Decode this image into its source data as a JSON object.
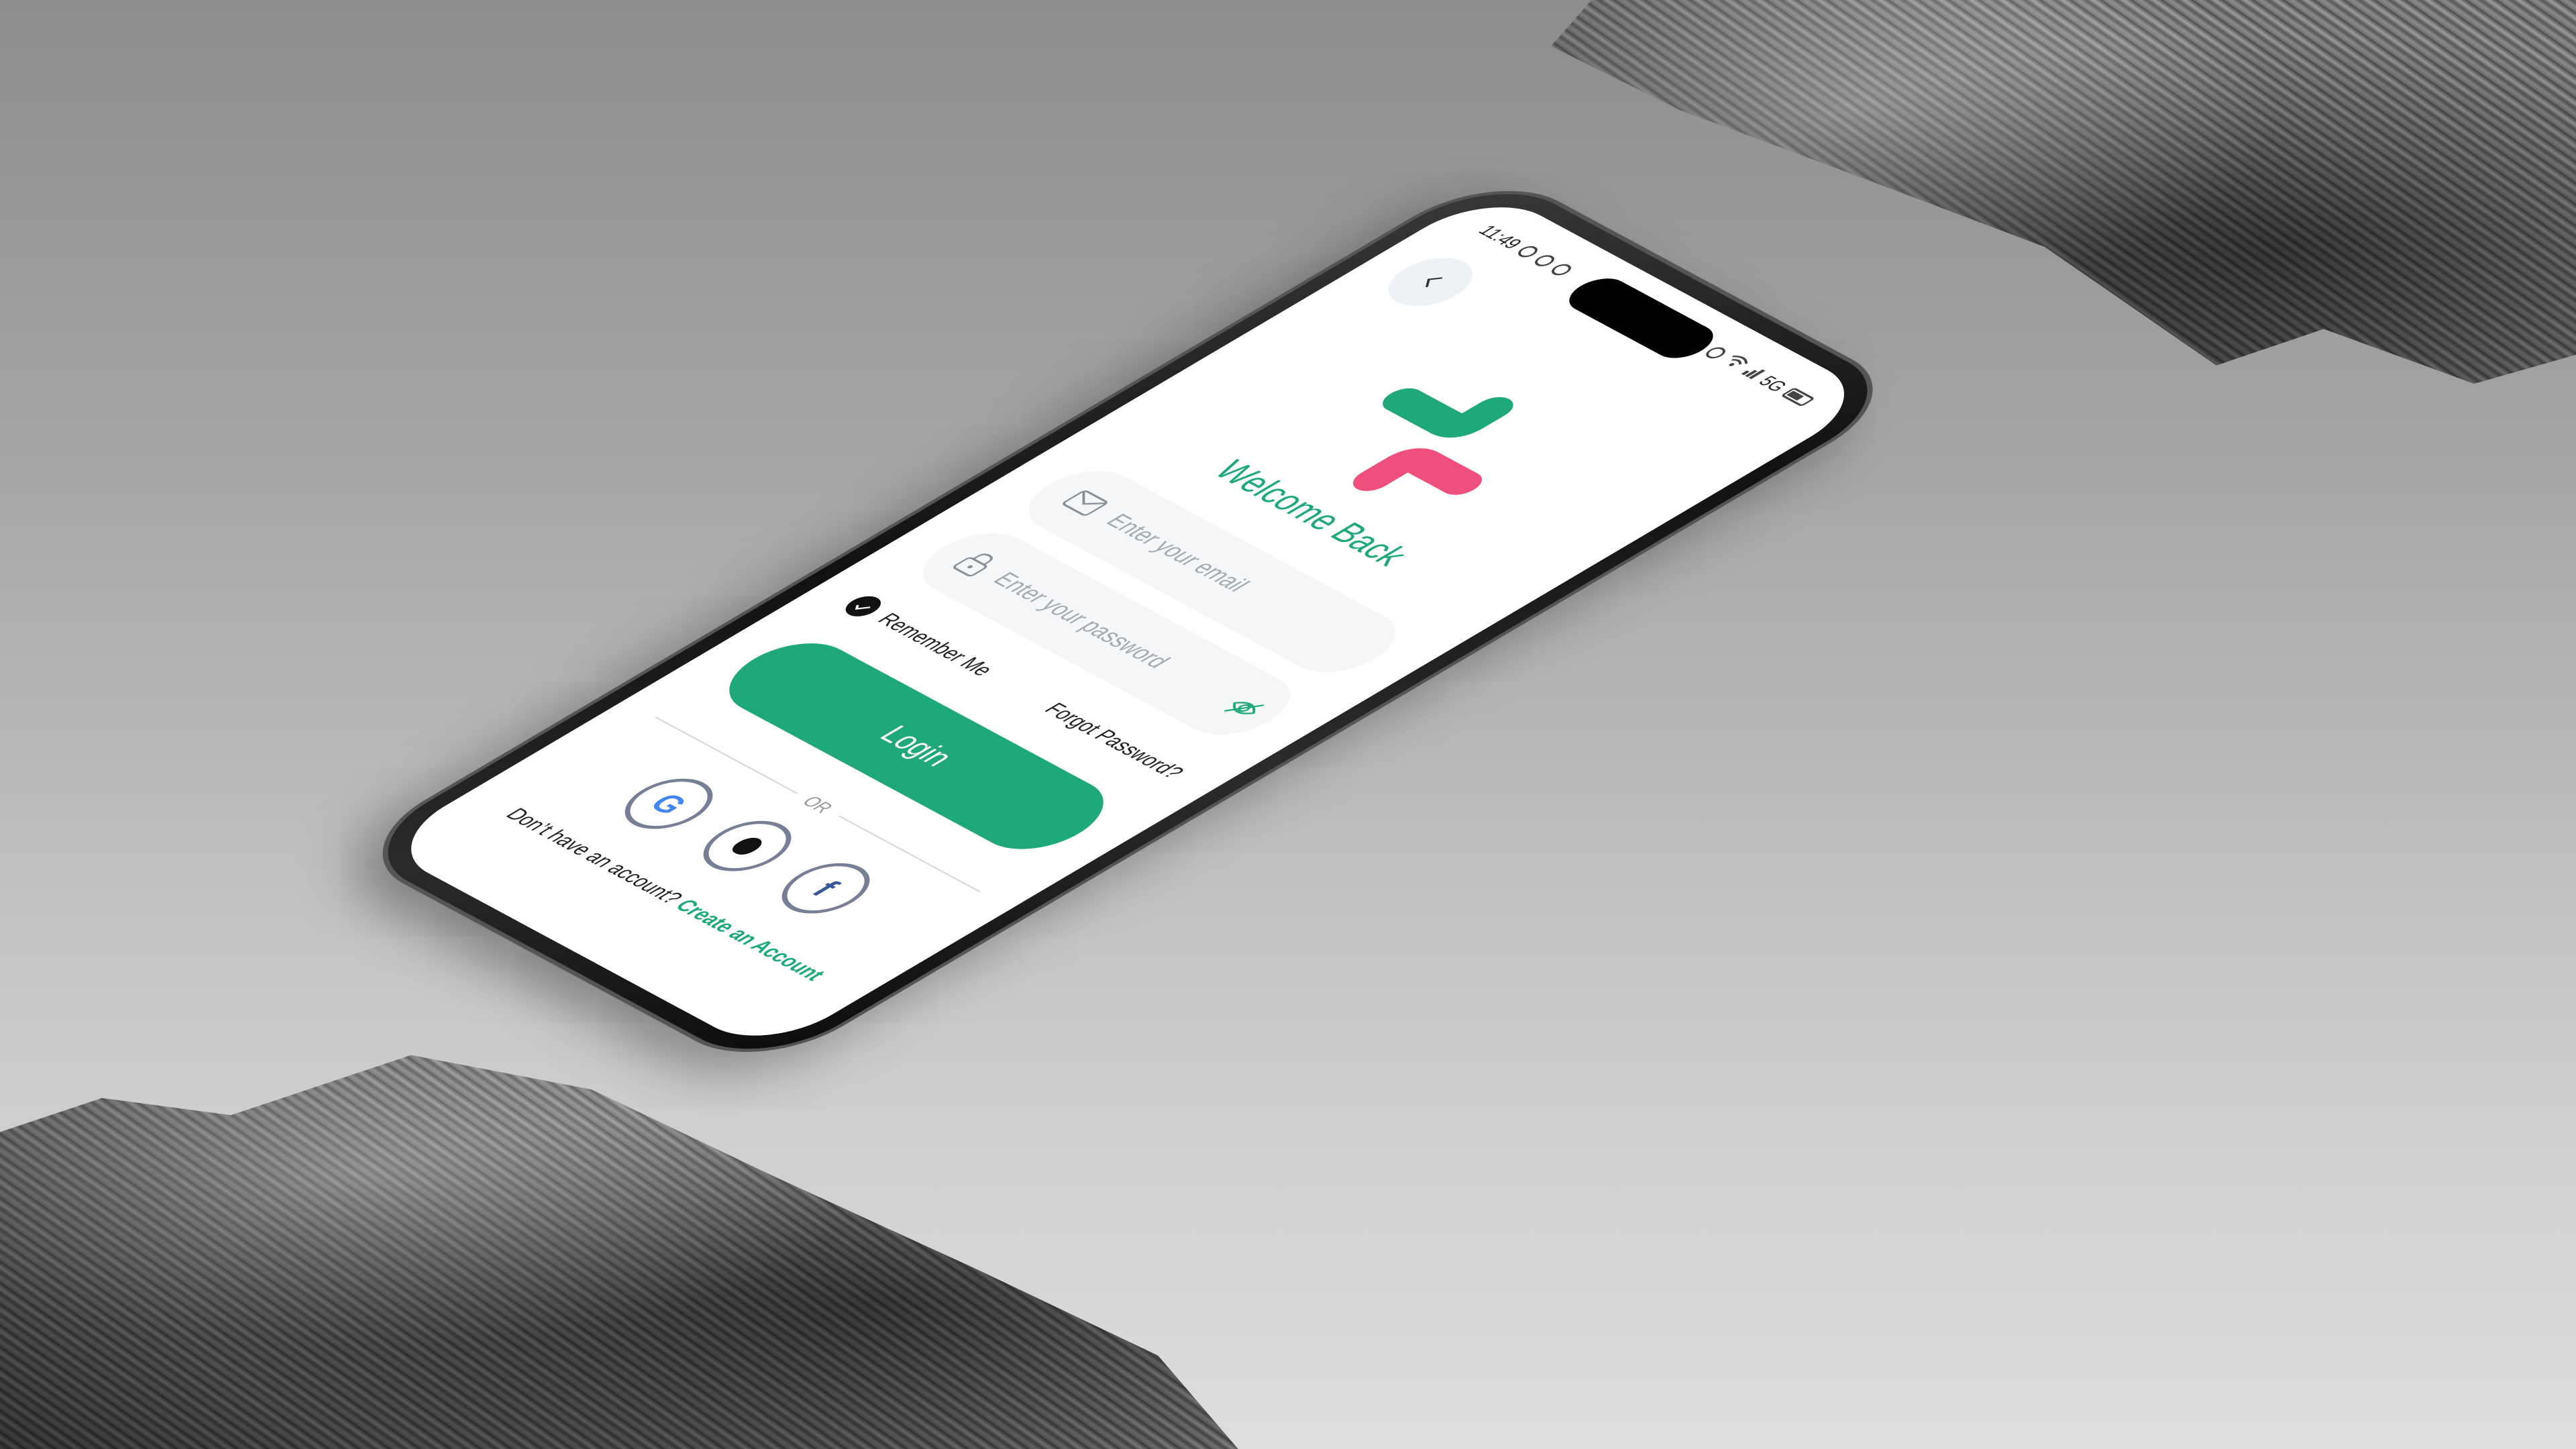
{
  "status_bar": {
    "time": "11:49",
    "network": "5G"
  },
  "screen": {
    "title": "Welcome Back",
    "email_placeholder": "Enter your email",
    "password_placeholder": "Enter your password",
    "remember_label": "Remember Me",
    "forgot_label": "Forgot Password?",
    "login_label": "Login",
    "or_label": "OR",
    "signup_prompt": "Don’t have an account?",
    "signup_link": "Create an Account"
  },
  "social": [
    {
      "name": "google",
      "glyph": "G"
    },
    {
      "name": "apple",
      "glyph": ""
    },
    {
      "name": "facebook",
      "glyph": "f"
    }
  ],
  "colors": {
    "accent": "#1fa97a",
    "logo_secondary": "#ef4f7c",
    "field_bg": "#f4f6f8",
    "social_border": "#767f96"
  },
  "icons": {
    "back": "chevron-left-icon",
    "email": "mail-icon",
    "password": "lock-icon",
    "visibility": "eye-off-icon",
    "remember_toggle": "check-circle-icon"
  }
}
